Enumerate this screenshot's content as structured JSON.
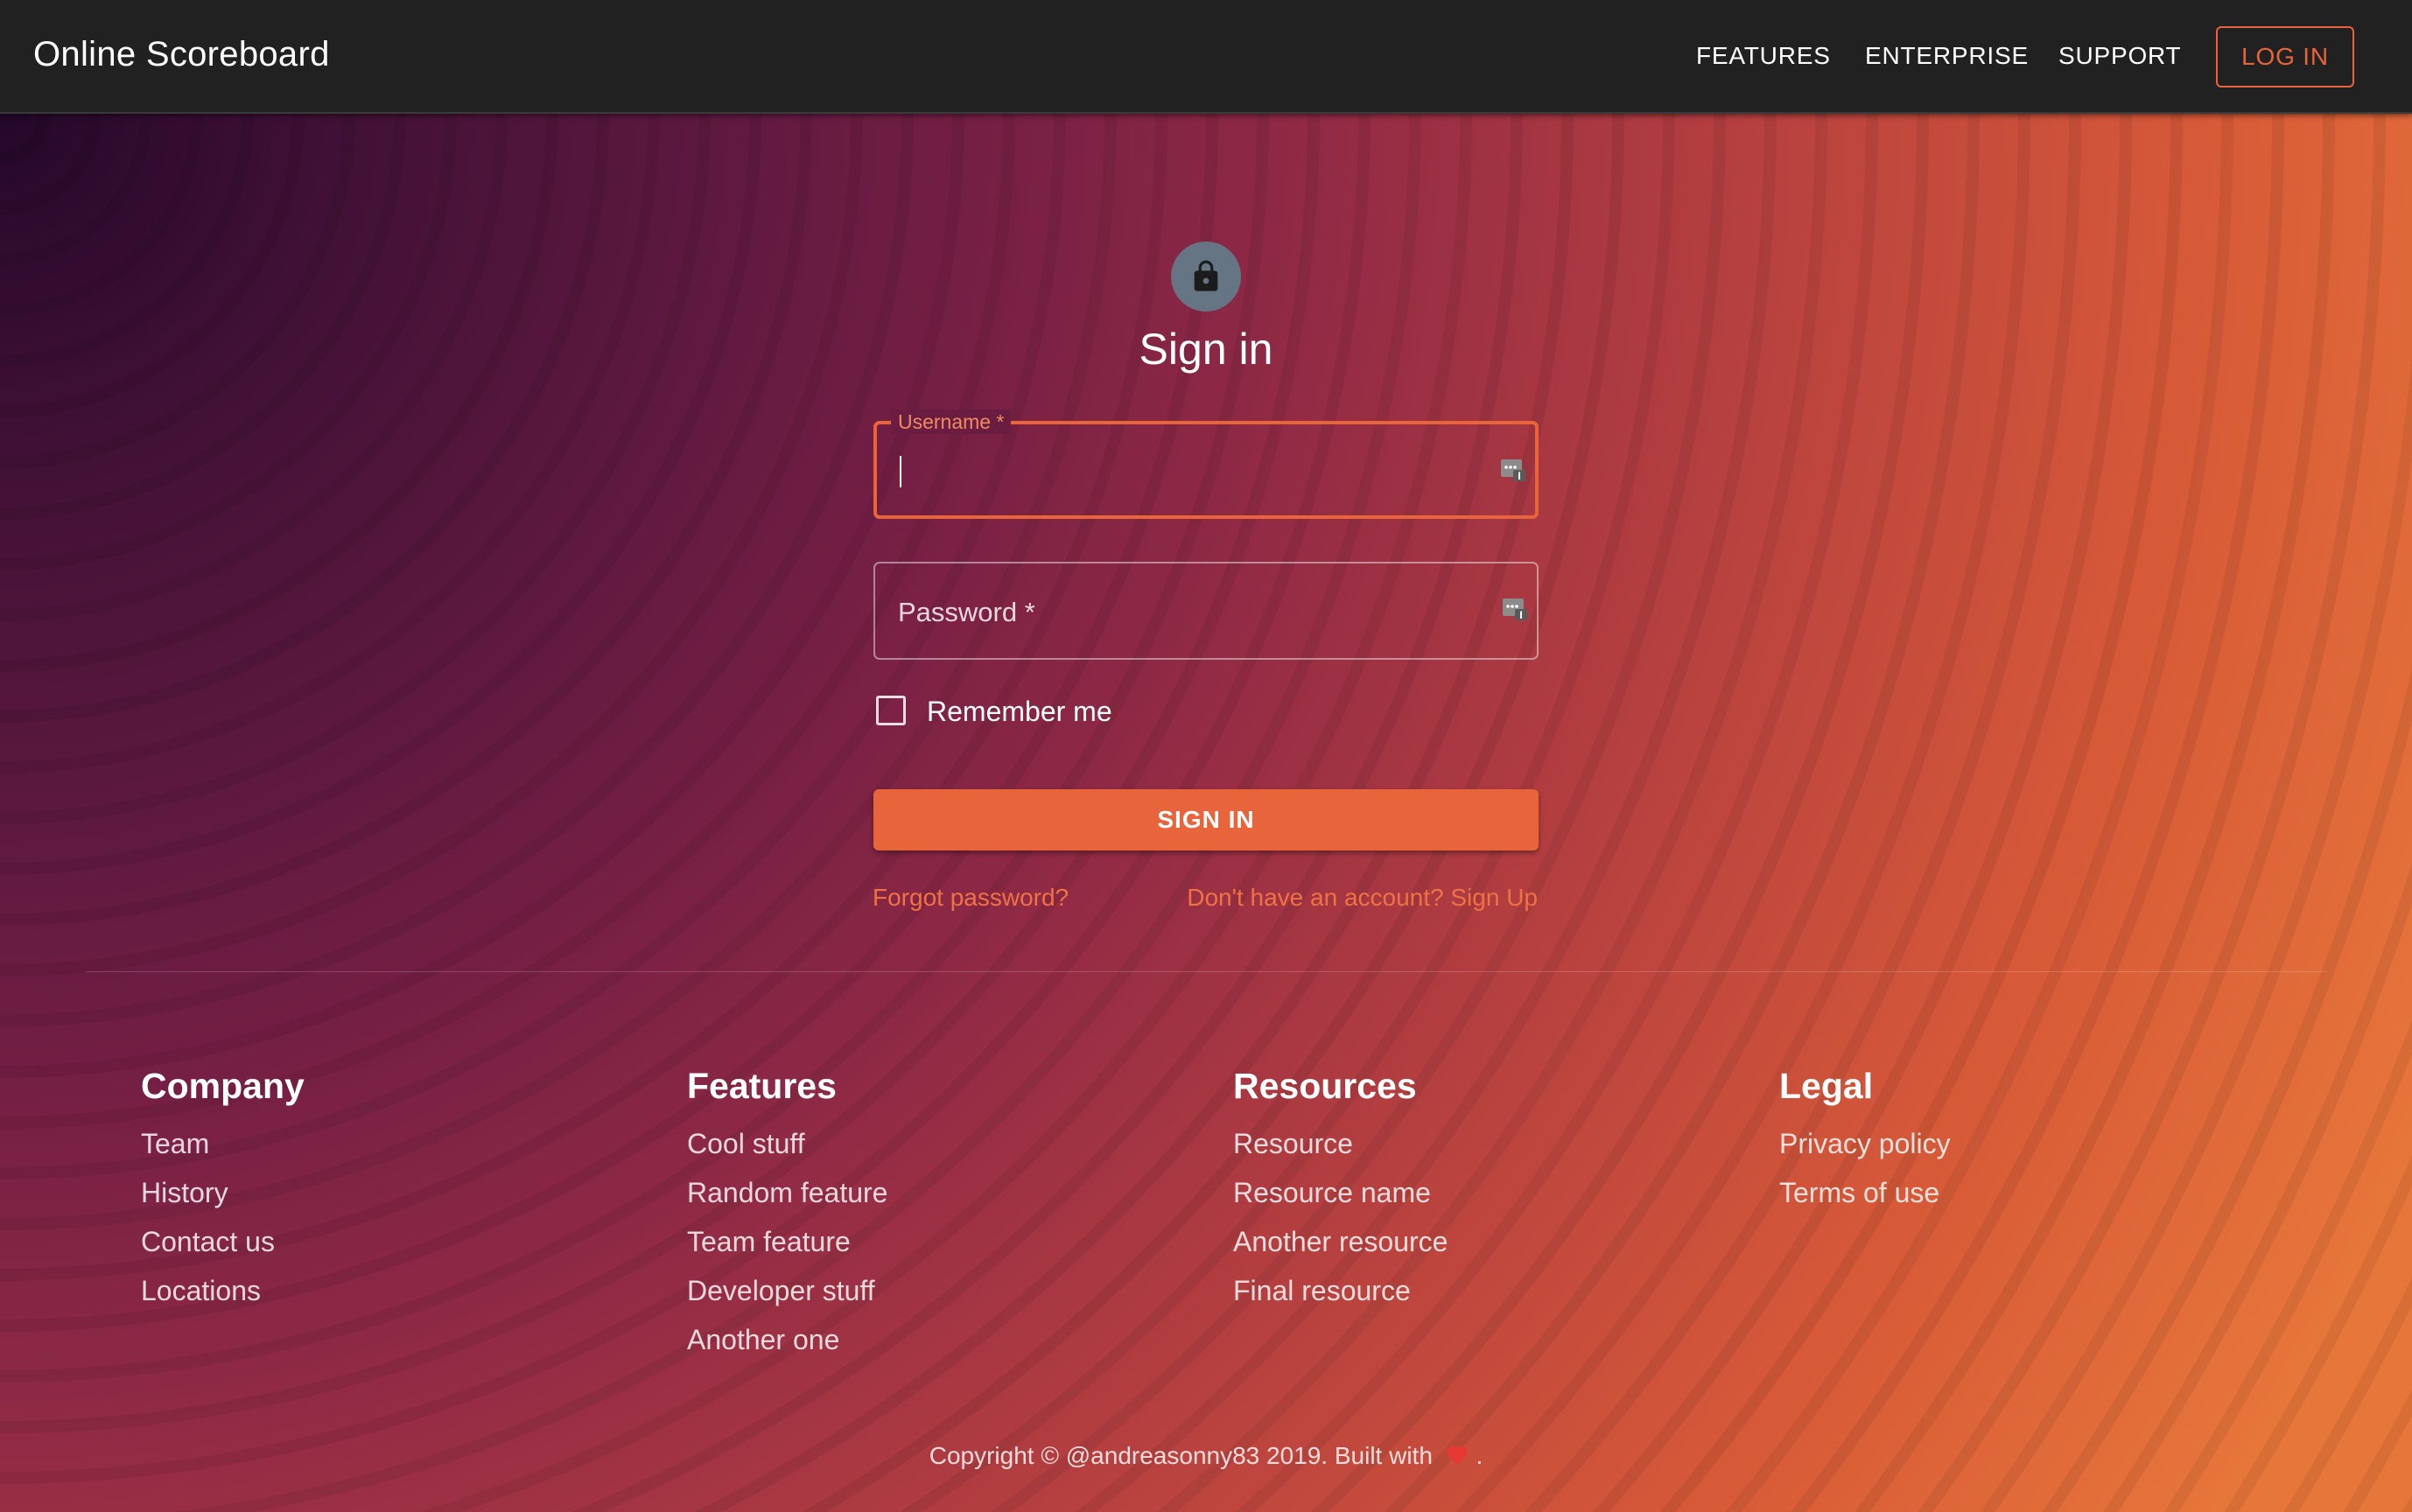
{
  "topbar": {
    "brand": "Online Scoreboard",
    "nav": [
      "FEATURES",
      "ENTERPRISE",
      "SUPPORT"
    ],
    "login_label": "LOG IN"
  },
  "signin": {
    "title": "Sign in",
    "username_label": "Username *",
    "password_placeholder": "Password *",
    "remember_label": "Remember me",
    "submit_label": "SIGN IN",
    "forgot_link": "Forgot password?",
    "signup_link": "Don't have an account? Sign Up"
  },
  "footer": {
    "columns": [
      {
        "title": "Company",
        "items": [
          "Team",
          "History",
          "Contact us",
          "Locations"
        ]
      },
      {
        "title": "Features",
        "items": [
          "Cool stuff",
          "Random feature",
          "Team feature",
          "Developer stuff",
          "Another one"
        ]
      },
      {
        "title": "Resources",
        "items": [
          "Resource",
          "Resource name",
          "Another resource",
          "Final resource"
        ]
      },
      {
        "title": "Legal",
        "items": [
          "Privacy policy",
          "Terms of use"
        ]
      }
    ],
    "copyright": "Copyright © @andreasonny83 2019. Built with",
    "copyright_end": "."
  },
  "colors": {
    "accent": "#e8643a",
    "topbar": "#212121",
    "avatar": "#657583",
    "heart": "#e53935"
  },
  "icons": {
    "avatar": "lock-icon",
    "password_manager": "password-manager-icon",
    "footer_heart": "heart-icon"
  }
}
